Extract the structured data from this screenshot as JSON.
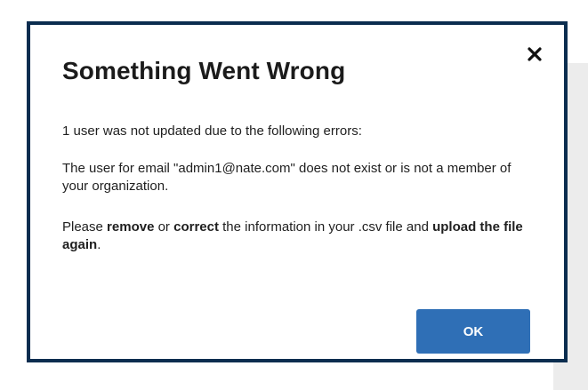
{
  "dialog": {
    "title": "Something Went Wrong",
    "close_icon": "close-icon",
    "message_summary": "1 user was not updated due to the following errors:",
    "error_detail": "The user for email \"admin1@nate.com\" does not exist or is not a member of your organization.",
    "instruction": {
      "prefix": "Please ",
      "remove": "remove",
      "or": " or ",
      "correct": "correct",
      "middle": " the information in your .csv file and ",
      "upload": "upload the file again",
      "suffix": "."
    },
    "ok_label": "OK"
  },
  "colors": {
    "border": "#0b2d4f",
    "button": "#2f6fb6",
    "backdrop": "#ececec"
  }
}
